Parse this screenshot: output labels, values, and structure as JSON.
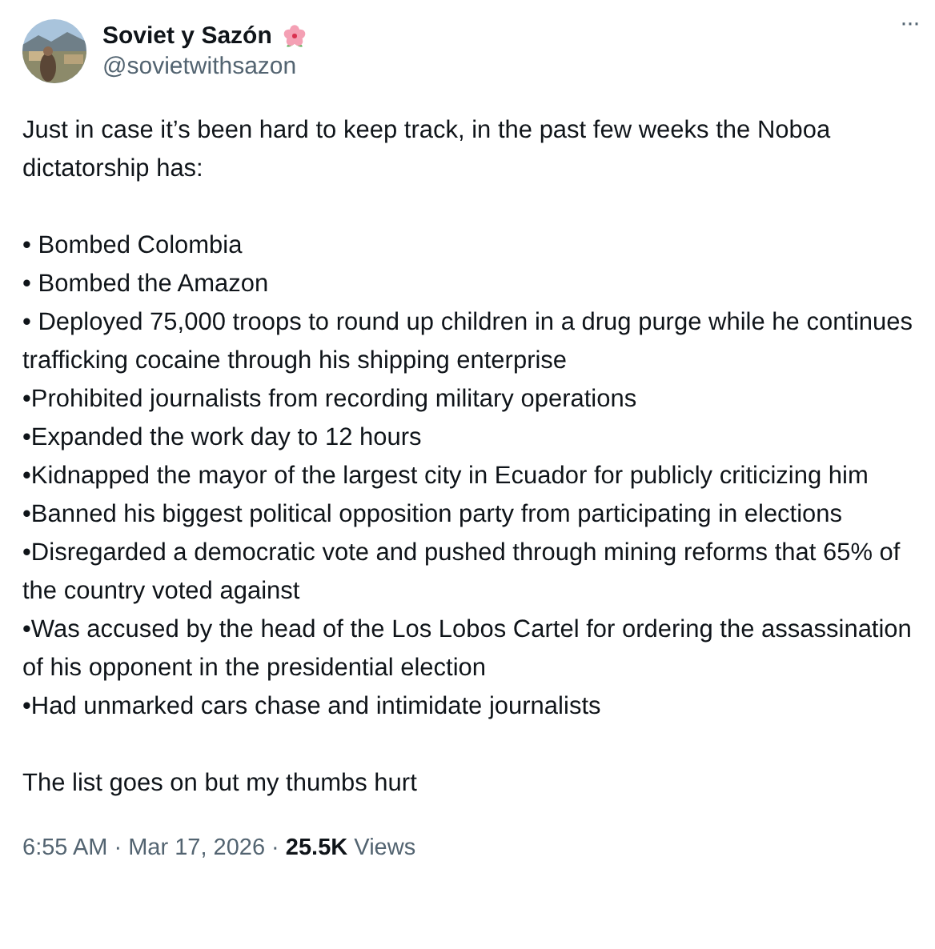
{
  "author": {
    "name": "Soviet y Sazón",
    "handle": "@sovietwithsazon"
  },
  "more": "···",
  "intro": "Just in case it’s been hard to keep track, in the past few weeks the Noboa dictatorship has:",
  "bullets": [
    "• Bombed Colombia",
    "• Bombed the Amazon",
    "• Deployed 75,000 troops to round up children in a drug purge while he continues trafficking cocaine through his shipping enterprise",
    "•Prohibited journalists from recording military operations",
    "•Expanded the work day to 12 hours",
    "•Kidnapped the mayor of the largest city in Ecuador for publicly criticizing him",
    "•Banned his biggest political opposition party from participating in elections",
    "•Disregarded a democratic vote and pushed through mining reforms that 65% of the country voted against",
    "•Was accused by the head of the Los Lobos Cartel for ordering the assassination of his opponent in the presidential election",
    "•Had unmarked cars chase and intimidate journalists"
  ],
  "outro": "The list goes on but my thumbs hurt",
  "meta": "6:55 AM · Mar 17, 2026 · **25.5K** Views"
}
